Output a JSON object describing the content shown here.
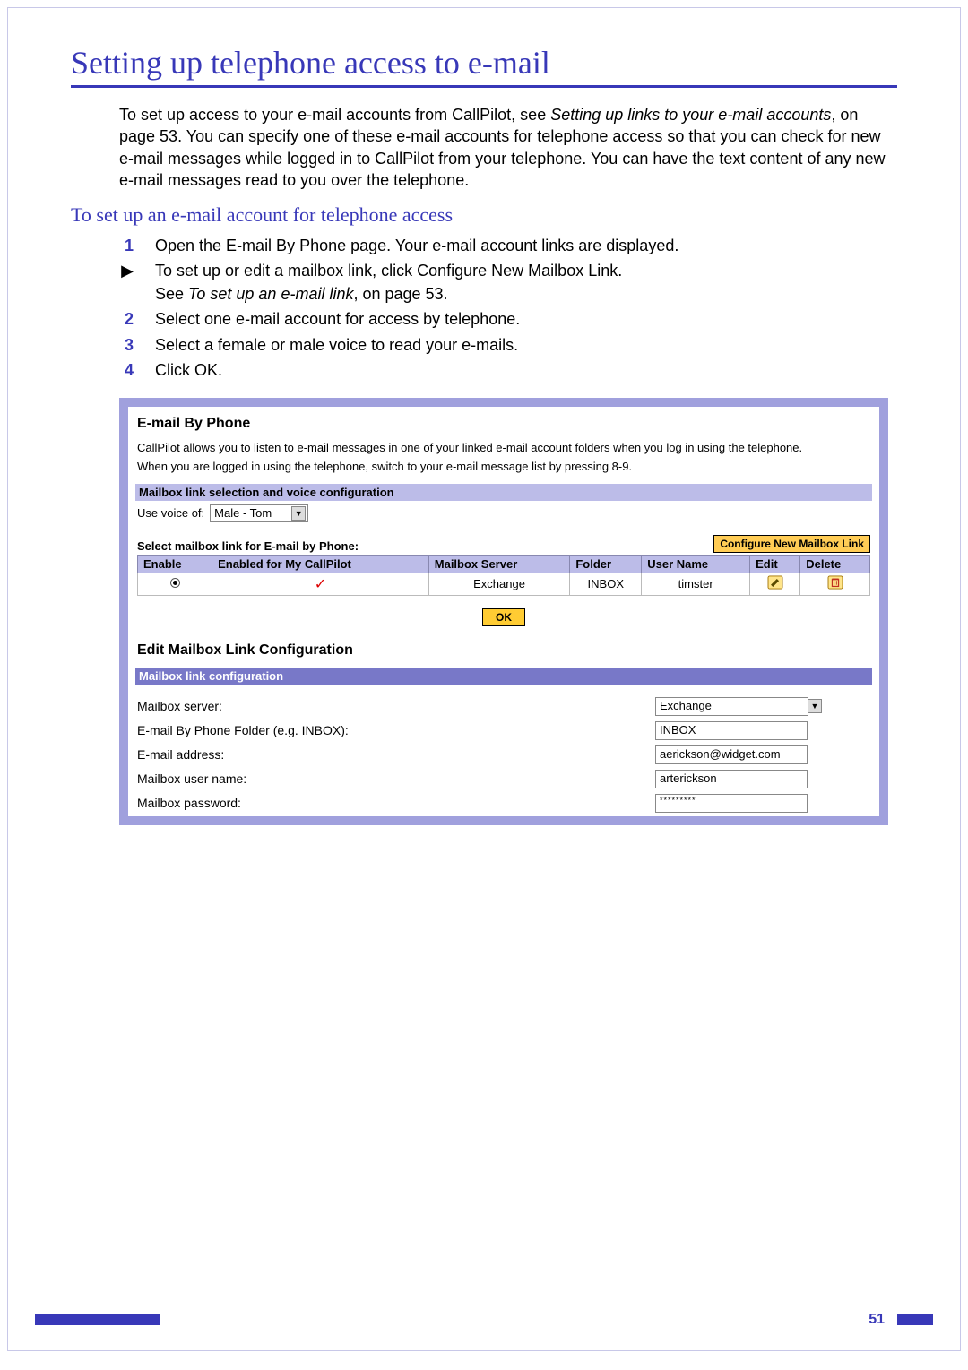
{
  "title": "Setting up telephone access to e-mail",
  "intro": {
    "pre": "To set up access to your e-mail accounts from CallPilot, see ",
    "link": "Setting up links to your e-mail accounts",
    "post": ", on page 53. You can specify one of these e-mail accounts for telephone access so that you can check for new e-mail messages while logged in to CallPilot from your telephone. You can have the text content of any new e-mail messages read to you over the telephone."
  },
  "subheading": "To set up an e-mail account for telephone access",
  "steps": [
    {
      "num": "1",
      "text": "Open the E-mail By Phone page. Your e-mail account links are displayed."
    },
    {
      "num": "▶",
      "text_pre": "To set up or edit a mailbox link, click Configure New Mailbox Link.\nSee ",
      "text_ital": "To set up an e-mail link",
      "text_post": ", on page 53."
    },
    {
      "num": "2",
      "text": "Select one e-mail account for access by telephone."
    },
    {
      "num": "3",
      "text": "Select a female or male voice to read your e-mails."
    },
    {
      "num": "4",
      "text": "Click OK."
    }
  ],
  "panel": {
    "email_by_phone_title": "E-mail By Phone",
    "help_para1": "CallPilot allows you to listen to e-mail messages in one of your linked e-mail account folders when you log in using the telephone.",
    "help_para2": "When you are logged in using the telephone, switch to your e-mail message list by pressing 8-9.",
    "link_sel_header": "Mailbox link selection and voice configuration",
    "voice_label": "Use voice of:",
    "voice_value": "Male - Tom",
    "select_label": "Select mailbox link for E-mail by Phone:",
    "config_btn": "Configure New Mailbox Link",
    "table_headers": {
      "enable": "Enable",
      "enabled_cp": "Enabled for My CallPilot",
      "server": "Mailbox Server",
      "folder": "Folder",
      "user": "User Name",
      "edit": "Edit",
      "delete": "Delete"
    },
    "row": {
      "server": "Exchange",
      "folder": "INBOX",
      "user": "timster"
    },
    "ok_label": "OK",
    "edit_title": "Edit Mailbox Link Configuration",
    "config_header": "Mailbox link configuration",
    "form": {
      "server_lbl": "Mailbox server:",
      "server_val": "Exchange",
      "folder_lbl": "E-mail By Phone Folder (e.g. INBOX):",
      "folder_val": "INBOX",
      "email_lbl": "E-mail address:",
      "email_val": "aerickson@widget.com",
      "user_lbl": "Mailbox user name:",
      "user_val": "arterickson",
      "pass_lbl": "Mailbox password:",
      "pass_val": "*********"
    }
  },
  "page_number": "51"
}
